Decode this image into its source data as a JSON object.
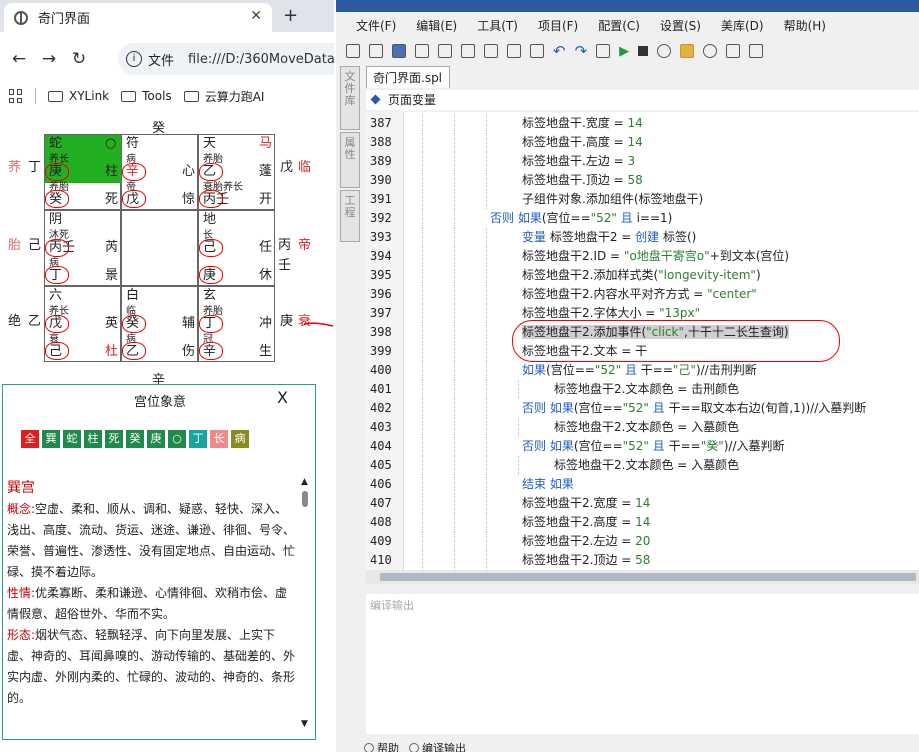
{
  "browser": {
    "tab_title": "奇门界面",
    "address_label": "文件",
    "url": "file:///D:/360MoveData",
    "bookmarks": [
      "XYLink",
      "Tools",
      "云算力跑AI"
    ]
  },
  "board": {
    "top": "癸",
    "bottom": "辛",
    "left": [
      {
        "a": "荞",
        "b": "丁"
      },
      {
        "a": "胎",
        "b": "己"
      },
      {
        "a": "绝",
        "b": "乙"
      }
    ],
    "right": [
      {
        "a": "戊",
        "b": "临"
      },
      {
        "a": "丙",
        "b": "帝",
        "c": "壬"
      },
      {
        "a": "庚",
        "b": "衰"
      }
    ],
    "cells": [
      {
        "t1": "蛇",
        "t2": "○",
        "m1": "养长",
        "m2": "庚",
        "m3": "柱",
        "b1": "养胎",
        "b2": "癸",
        "b3": "死"
      },
      {
        "t1": "符",
        "t2": "",
        "m1": "病",
        "m2": "辛",
        "m3": "心",
        "b1": "帝",
        "b2": "戊",
        "b3": "惊"
      },
      {
        "t1": "天",
        "t2": "马",
        "m1": "养胎",
        "m2": "乙",
        "m3": "蓬",
        "b1": "衰胎养长",
        "b2": "丙壬",
        "b3": "开"
      },
      {
        "t1": "阴",
        "t2": "",
        "m1": "沐死",
        "m2": "丙壬",
        "m3": "芮",
        "b1": "病",
        "b2": "丁",
        "b3": "景"
      },
      {
        "t1": "",
        "t2": "",
        "m1": "",
        "m2": "",
        "m3": "",
        "b1": "",
        "b2": "",
        "b3": ""
      },
      {
        "t1": "地",
        "t2": "",
        "m1": "长",
        "m2": "己",
        "m3": "任",
        "b1": "",
        "b2": "庚",
        "b3": "休"
      },
      {
        "t1": "六",
        "t2": "",
        "m1": "养长",
        "m2": "戊",
        "m3": "英",
        "b1": "衰",
        "b2": "己",
        "b3": "杜"
      },
      {
        "t1": "白",
        "t2": "",
        "m1": "临",
        "m2": "癸",
        "m3": "辅",
        "b1": "病",
        "b2": "乙",
        "b3": "伤"
      },
      {
        "t1": "玄",
        "t2": "",
        "m1": "养胎",
        "m2": "丁",
        "m3": "冲",
        "b1": "冠",
        "b2": "辛",
        "b3": "生"
      }
    ]
  },
  "dialog": {
    "title": "宫位象意",
    "close": "X",
    "tags": [
      {
        "t": "全",
        "c": "#e11d1d"
      },
      {
        "t": "巽",
        "c": "#1f8a4c"
      },
      {
        "t": "蛇",
        "c": "#1f8a4c"
      },
      {
        "t": "柱",
        "c": "#1f8a4c"
      },
      {
        "t": "死",
        "c": "#1f8a4c"
      },
      {
        "t": "癸",
        "c": "#1f8a4c"
      },
      {
        "t": "庚",
        "c": "#1f8a4c"
      },
      {
        "t": "○",
        "c": "#1f8a4c"
      },
      {
        "t": "丁",
        "c": "#1aa3a3"
      },
      {
        "t": "长",
        "c": "#f08a8a"
      },
      {
        "t": "病",
        "c": "#8a8a1f"
      }
    ],
    "palace": "巽宫",
    "sections": [
      {
        "k": "概念:",
        "v": "空虚、柔和、顺从、调和、疑惑、轻快、深入、浅出、高度、流动、货运、迷途、谦逊、徘徊、号令、荣誉、普遍性、渗透性、没有固定地点、自由运动、忙碌、摸不着边际。"
      },
      {
        "k": "性情:",
        "v": "优柔寡断、柔和谦逊、心情徘徊、欢稍市侩、虚情假意、超俗世外、华而不实。"
      },
      {
        "k": "形态:",
        "v": "烟状气态、轻飘轻浮、向下向里发展、上实下虚、神奇的、耳闻鼻嗅的、游动传输的、基础差的、外实内虚、外刚内柔的、忙碌的、波动的、神奇的、条形的。"
      }
    ]
  },
  "ide": {
    "menus": [
      "文件(F)",
      "编辑(E)",
      "工具(T)",
      "项目(F)",
      "配置(C)",
      "设置(S)",
      "美库(D)",
      "帮助(H)"
    ],
    "tab": "奇门界面.spl",
    "vars": "页面变量",
    "sidetabs": [
      "文件库",
      "属性",
      "工程"
    ],
    "output_label": "编译输出",
    "bottom_tabs": [
      "帮助",
      "编译输出"
    ],
    "lines": [
      {
        "n": "387",
        "ind": 7,
        "seg": [
          [
            "标签地盘干.宽度 = ",
            ""
          ],
          [
            "14",
            "st"
          ]
        ]
      },
      {
        "n": "388",
        "ind": 7,
        "seg": [
          [
            "标签地盘干.高度 = ",
            ""
          ],
          [
            "14",
            "st"
          ]
        ]
      },
      {
        "n": "389",
        "ind": 7,
        "seg": [
          [
            "标签地盘干.左边 = ",
            ""
          ],
          [
            "3",
            "st"
          ]
        ]
      },
      {
        "n": "390",
        "ind": 7,
        "seg": [
          [
            "标签地盘干.顶边 = ",
            ""
          ],
          [
            "58",
            "st"
          ]
        ]
      },
      {
        "n": "391",
        "ind": 7,
        "seg": [
          [
            "子组件对象.添加组件(标签地盘干)",
            ""
          ]
        ]
      },
      {
        "n": "392",
        "ind": 5,
        "seg": [
          [
            "否则 如果",
            "kw"
          ],
          [
            "(宫位==",
            ""
          ],
          [
            "\"52\"",
            "st"
          ],
          [
            " 且 ",
            "kw"
          ],
          [
            "i==1)",
            ""
          ]
        ]
      },
      {
        "n": "393",
        "ind": 7,
        "seg": [
          [
            "变量",
            "kw"
          ],
          [
            " 标签地盘干2 = ",
            ""
          ],
          [
            "创建",
            "kw"
          ],
          [
            " 标签()",
            ""
          ]
        ]
      },
      {
        "n": "394",
        "ind": 7,
        "seg": [
          [
            "标签地盘干2.ID = ",
            ""
          ],
          [
            "\"o地盘干寄宫o\"",
            "st"
          ],
          [
            "+到文本(宫位)",
            ""
          ]
        ]
      },
      {
        "n": "395",
        "ind": 7,
        "seg": [
          [
            "标签地盘干2.添加样式类(",
            ""
          ],
          [
            "\"longevity-item\"",
            "st"
          ],
          [
            ")",
            ""
          ]
        ]
      },
      {
        "n": "396",
        "ind": 7,
        "seg": [
          [
            "标签地盘干2.内容水平对齐方式 = ",
            ""
          ],
          [
            "\"center\"",
            "st"
          ]
        ]
      },
      {
        "n": "397",
        "ind": 7,
        "seg": [
          [
            "标签地盘干2.字体大小 = ",
            ""
          ],
          [
            "\"13px\"",
            "st"
          ]
        ]
      },
      {
        "n": "398",
        "ind": 7,
        "hl": true,
        "seg": [
          [
            "标签地盘干2.添加事件(",
            ""
          ],
          [
            "\"click\"",
            "st"
          ],
          [
            ",十干十二长生查询)",
            ""
          ]
        ]
      },
      {
        "n": "399",
        "ind": 7,
        "seg": [
          [
            "标签地盘干2.文本 = 干",
            ""
          ]
        ]
      },
      {
        "n": "400",
        "ind": 7,
        "seg": [
          [
            "如果",
            "kw"
          ],
          [
            "(宫位==",
            ""
          ],
          [
            "\"52\"",
            "st"
          ],
          [
            " 且 ",
            "kw"
          ],
          [
            "干==",
            ""
          ],
          [
            "\"己\"",
            "st"
          ],
          [
            ")//击刑判断",
            ""
          ]
        ]
      },
      {
        "n": "401",
        "ind": 9,
        "seg": [
          [
            "标签地盘干2.文本颜色 = 击刑颜色",
            ""
          ]
        ]
      },
      {
        "n": "402",
        "ind": 7,
        "seg": [
          [
            "否则 如果",
            "kw"
          ],
          [
            "(宫位==",
            ""
          ],
          [
            "\"52\"",
            "st"
          ],
          [
            " 且 ",
            "kw"
          ],
          [
            "干==取文本右边(旬首,1))//入墓判断",
            ""
          ]
        ]
      },
      {
        "n": "403",
        "ind": 9,
        "seg": [
          [
            "标签地盘干2.文本颜色 = 入墓颜色",
            ""
          ]
        ]
      },
      {
        "n": "404",
        "ind": 7,
        "seg": [
          [
            "否则 如果",
            "kw"
          ],
          [
            "(宫位==",
            ""
          ],
          [
            "\"52\"",
            "st"
          ],
          [
            " 且 ",
            "kw"
          ],
          [
            "干==",
            ""
          ],
          [
            "\"癸\"",
            "st"
          ],
          [
            ")//入墓判断",
            ""
          ]
        ]
      },
      {
        "n": "405",
        "ind": 9,
        "seg": [
          [
            "标签地盘干2.文本颜色 = 入墓颜色",
            ""
          ]
        ]
      },
      {
        "n": "406",
        "ind": 7,
        "seg": [
          [
            "结束 如果",
            "kw"
          ]
        ]
      },
      {
        "n": "407",
        "ind": 7,
        "seg": [
          [
            "标签地盘干2.宽度 = ",
            ""
          ],
          [
            "14",
            "st"
          ]
        ]
      },
      {
        "n": "408",
        "ind": 7,
        "seg": [
          [
            "标签地盘干2.高度 = ",
            ""
          ],
          [
            "14",
            "st"
          ]
        ]
      },
      {
        "n": "409",
        "ind": 7,
        "seg": [
          [
            "标签地盘干2.左边 = ",
            ""
          ],
          [
            "20",
            "st"
          ]
        ]
      },
      {
        "n": "410",
        "ind": 7,
        "seg": [
          [
            "标签地盘干2.顶边 = ",
            ""
          ],
          [
            "58",
            "st"
          ]
        ]
      }
    ]
  }
}
